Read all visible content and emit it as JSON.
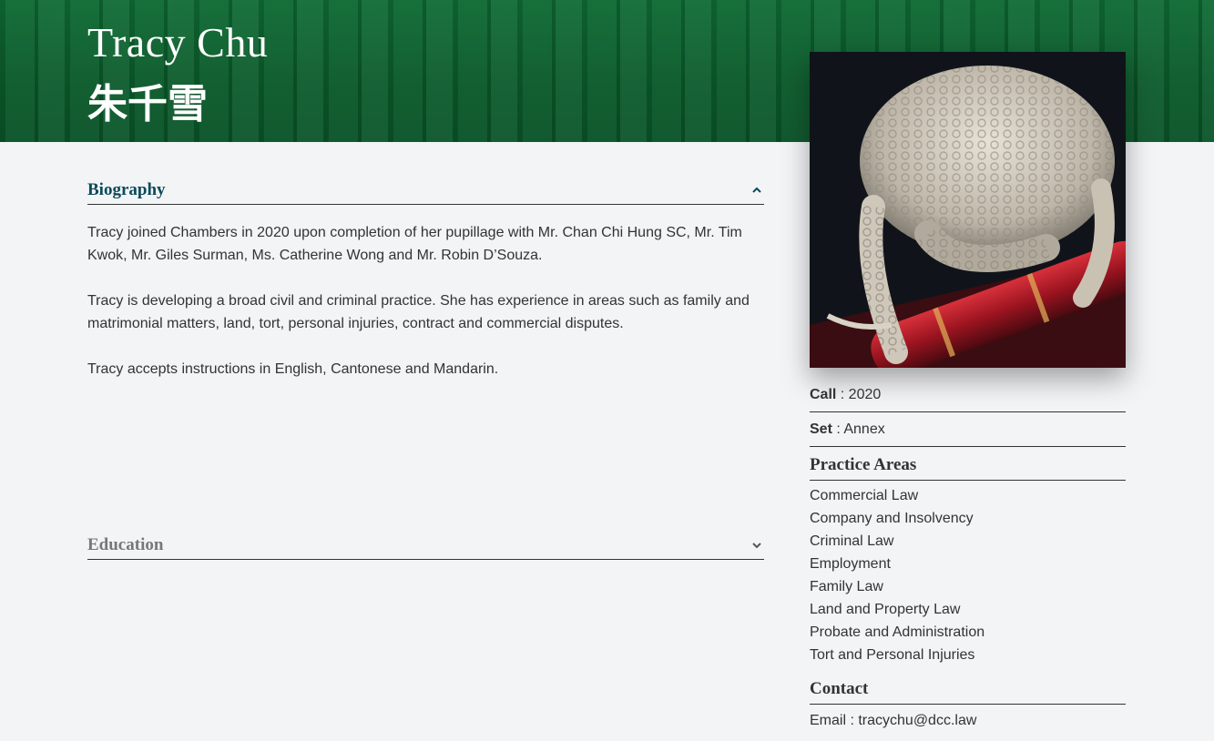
{
  "profile": {
    "name_en": "Tracy Chu",
    "name_zh": "朱千雪"
  },
  "biography": {
    "title": "Biography",
    "expanded": true,
    "paragraphs": [
      "Tracy joined Chambers in 2020 upon completion of her pupillage with Mr. Chan Chi Hung SC, Mr. Tim Kwok, Mr. Giles Surman, Ms. Catherine Wong and Mr. Robin D’Souza.",
      "Tracy is developing a broad civil and criminal practice. She has experience in areas such as family and matrimonial matters, land, tort, personal injuries, contract and commercial disputes.",
      "Tracy accepts instructions in English, Cantonese and Mandarin."
    ]
  },
  "education": {
    "title": "Education",
    "expanded": false
  },
  "details": {
    "call_label": "Call",
    "call_value": " : 2020",
    "set_label": "Set",
    "set_value": " : Annex"
  },
  "practice_areas": {
    "title": "Practice Areas",
    "items": [
      "Commercial Law",
      "Company and Insolvency",
      "Criminal Law",
      "Employment",
      "Family Law",
      "Land and Property Law",
      "Probate and Administration",
      "Tort and Personal Injuries"
    ]
  },
  "contact": {
    "title": "Contact",
    "email_label": "Email : ",
    "email": "tracychu@dcc.law"
  },
  "colors": {
    "banner_green": "#0b5a2b",
    "heading_teal": "#0c4a5a",
    "page_bg": "#f3f4f6"
  },
  "icons": {
    "collapse": "chevron-up-icon",
    "expand": "chevron-down-icon"
  }
}
